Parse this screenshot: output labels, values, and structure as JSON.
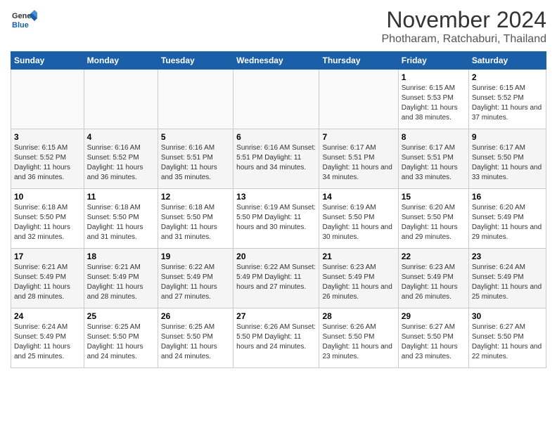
{
  "header": {
    "logo_general": "General",
    "logo_blue": "Blue",
    "month_title": "November 2024",
    "subtitle": "Photharam, Ratchaburi, Thailand"
  },
  "weekdays": [
    "Sunday",
    "Monday",
    "Tuesday",
    "Wednesday",
    "Thursday",
    "Friday",
    "Saturday"
  ],
  "weeks": [
    [
      {
        "day": "",
        "info": ""
      },
      {
        "day": "",
        "info": ""
      },
      {
        "day": "",
        "info": ""
      },
      {
        "day": "",
        "info": ""
      },
      {
        "day": "",
        "info": ""
      },
      {
        "day": "1",
        "info": "Sunrise: 6:15 AM\nSunset: 5:53 PM\nDaylight: 11 hours\nand 38 minutes."
      },
      {
        "day": "2",
        "info": "Sunrise: 6:15 AM\nSunset: 5:52 PM\nDaylight: 11 hours\nand 37 minutes."
      }
    ],
    [
      {
        "day": "3",
        "info": "Sunrise: 6:15 AM\nSunset: 5:52 PM\nDaylight: 11 hours\nand 36 minutes."
      },
      {
        "day": "4",
        "info": "Sunrise: 6:16 AM\nSunset: 5:52 PM\nDaylight: 11 hours\nand 36 minutes."
      },
      {
        "day": "5",
        "info": "Sunrise: 6:16 AM\nSunset: 5:51 PM\nDaylight: 11 hours\nand 35 minutes."
      },
      {
        "day": "6",
        "info": "Sunrise: 6:16 AM\nSunset: 5:51 PM\nDaylight: 11 hours\nand 34 minutes."
      },
      {
        "day": "7",
        "info": "Sunrise: 6:17 AM\nSunset: 5:51 PM\nDaylight: 11 hours\nand 34 minutes."
      },
      {
        "day": "8",
        "info": "Sunrise: 6:17 AM\nSunset: 5:51 PM\nDaylight: 11 hours\nand 33 minutes."
      },
      {
        "day": "9",
        "info": "Sunrise: 6:17 AM\nSunset: 5:50 PM\nDaylight: 11 hours\nand 33 minutes."
      }
    ],
    [
      {
        "day": "10",
        "info": "Sunrise: 6:18 AM\nSunset: 5:50 PM\nDaylight: 11 hours\nand 32 minutes."
      },
      {
        "day": "11",
        "info": "Sunrise: 6:18 AM\nSunset: 5:50 PM\nDaylight: 11 hours\nand 31 minutes."
      },
      {
        "day": "12",
        "info": "Sunrise: 6:18 AM\nSunset: 5:50 PM\nDaylight: 11 hours\nand 31 minutes."
      },
      {
        "day": "13",
        "info": "Sunrise: 6:19 AM\nSunset: 5:50 PM\nDaylight: 11 hours\nand 30 minutes."
      },
      {
        "day": "14",
        "info": "Sunrise: 6:19 AM\nSunset: 5:50 PM\nDaylight: 11 hours\nand 30 minutes."
      },
      {
        "day": "15",
        "info": "Sunrise: 6:20 AM\nSunset: 5:50 PM\nDaylight: 11 hours\nand 29 minutes."
      },
      {
        "day": "16",
        "info": "Sunrise: 6:20 AM\nSunset: 5:49 PM\nDaylight: 11 hours\nand 29 minutes."
      }
    ],
    [
      {
        "day": "17",
        "info": "Sunrise: 6:21 AM\nSunset: 5:49 PM\nDaylight: 11 hours\nand 28 minutes."
      },
      {
        "day": "18",
        "info": "Sunrise: 6:21 AM\nSunset: 5:49 PM\nDaylight: 11 hours\nand 28 minutes."
      },
      {
        "day": "19",
        "info": "Sunrise: 6:22 AM\nSunset: 5:49 PM\nDaylight: 11 hours\nand 27 minutes."
      },
      {
        "day": "20",
        "info": "Sunrise: 6:22 AM\nSunset: 5:49 PM\nDaylight: 11 hours\nand 27 minutes."
      },
      {
        "day": "21",
        "info": "Sunrise: 6:23 AM\nSunset: 5:49 PM\nDaylight: 11 hours\nand 26 minutes."
      },
      {
        "day": "22",
        "info": "Sunrise: 6:23 AM\nSunset: 5:49 PM\nDaylight: 11 hours\nand 26 minutes."
      },
      {
        "day": "23",
        "info": "Sunrise: 6:24 AM\nSunset: 5:49 PM\nDaylight: 11 hours\nand 25 minutes."
      }
    ],
    [
      {
        "day": "24",
        "info": "Sunrise: 6:24 AM\nSunset: 5:49 PM\nDaylight: 11 hours\nand 25 minutes."
      },
      {
        "day": "25",
        "info": "Sunrise: 6:25 AM\nSunset: 5:50 PM\nDaylight: 11 hours\nand 24 minutes."
      },
      {
        "day": "26",
        "info": "Sunrise: 6:25 AM\nSunset: 5:50 PM\nDaylight: 11 hours\nand 24 minutes."
      },
      {
        "day": "27",
        "info": "Sunrise: 6:26 AM\nSunset: 5:50 PM\nDaylight: 11 hours\nand 24 minutes."
      },
      {
        "day": "28",
        "info": "Sunrise: 6:26 AM\nSunset: 5:50 PM\nDaylight: 11 hours\nand 23 minutes."
      },
      {
        "day": "29",
        "info": "Sunrise: 6:27 AM\nSunset: 5:50 PM\nDaylight: 11 hours\nand 23 minutes."
      },
      {
        "day": "30",
        "info": "Sunrise: 6:27 AM\nSunset: 5:50 PM\nDaylight: 11 hours\nand 22 minutes."
      }
    ]
  ]
}
